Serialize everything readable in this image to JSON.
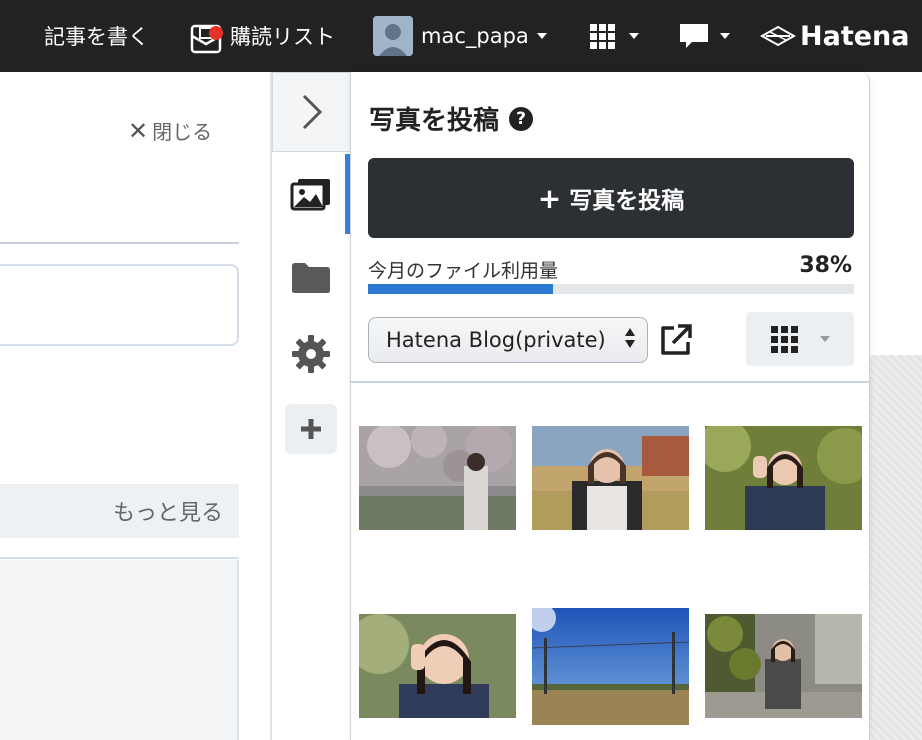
{
  "topbar": {
    "write_label": "記事を書く",
    "subscribe_label": "購読リスト",
    "username": "mac_papa",
    "brand": "Hatena",
    "bg_color": "#222222",
    "notification_color": "#e5332a"
  },
  "editor": {
    "close_label": "閉じる",
    "more_label": "もっと見る"
  },
  "panel": {
    "title": "写真を投稿",
    "post_button_label": "写真を投稿",
    "usage_label": "今月のファイル利用量",
    "usage_percent": "38%",
    "usage_fraction": 0.38,
    "blog_select_value": "Hatena Blog(private)",
    "accent_color": "#2a78d0"
  },
  "side_tools": {
    "icons": [
      "chevron-right-icon",
      "images-icon",
      "folder-icon",
      "gear-icon",
      "plus-icon"
    ],
    "active_index": 1
  },
  "photos": [
    {
      "name": "photo-cherry-blossom-portrait"
    },
    {
      "name": "photo-vest-portrait"
    },
    {
      "name": "photo-denim-jacket-portrait"
    },
    {
      "name": "photo-closeup-portrait"
    },
    {
      "name": "photo-blue-sky-field"
    },
    {
      "name": "photo-ivy-wall-portrait"
    }
  ]
}
